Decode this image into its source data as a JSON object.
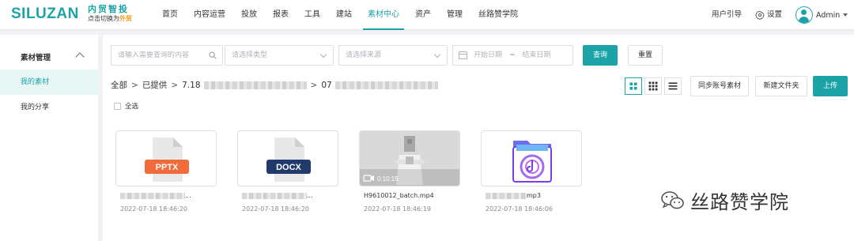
{
  "brand": {
    "logo_text": "SILUZAN",
    "name": "内贸智投",
    "switch_prefix": "点击切换为",
    "switch_target": "外贸"
  },
  "nav": {
    "items": [
      {
        "label": "首页"
      },
      {
        "label": "内容运营"
      },
      {
        "label": "投放"
      },
      {
        "label": "报表"
      },
      {
        "label": "工具"
      },
      {
        "label": "建站"
      },
      {
        "label": "素材中心"
      },
      {
        "label": "资产"
      },
      {
        "label": "管理"
      },
      {
        "label": "丝路赞学院"
      }
    ],
    "active_index": 6
  },
  "header_right": {
    "guide": "用户引导",
    "settings": "设置",
    "user": "Admin"
  },
  "sidebar": {
    "group_label": "素材管理",
    "items": [
      {
        "label": "我的素材",
        "active": true
      },
      {
        "label": "我的分享",
        "active": false
      }
    ]
  },
  "filters": {
    "search_placeholder": "请输入需要查询的内容",
    "type_placeholder": "请选择类型",
    "source_placeholder": "请选择来源",
    "start_date": "开始日期",
    "date_sep": "~",
    "end_date": "结束日期",
    "query_button": "查询",
    "reset_button": "重置"
  },
  "breadcrumb": {
    "root": "全部",
    "level1": "已提供",
    "level2_prefix": "7.18",
    "level3_prefix": "07"
  },
  "toolbar": {
    "sync_button": "同步账号素材",
    "new_folder_button": "新建文件夹",
    "upload_button": "上传"
  },
  "select_all_label": "全选",
  "files": [
    {
      "type_label": "PPTX",
      "name_suffix": "...",
      "date": "2022-07-18 18:46:20"
    },
    {
      "type_label": "DOCX",
      "name_suffix": "...",
      "date": "2022-07-18 18:46:20"
    },
    {
      "type_label": "video",
      "duration": "0:10:15",
      "name": "H9610012_batch.mp4",
      "date": "2022-07-18 18:46:19"
    },
    {
      "type_label": "audio",
      "name_suffix": "mp3",
      "date": "2022-07-18 18:46:06"
    }
  ],
  "watermark": "丝路赞学院",
  "colors": {
    "accent": "#1ca3a8",
    "pptx": "#f26b3a",
    "docx": "#1f3a6b",
    "audio": "#7b3fe4",
    "brand_orange": "#f39c12"
  }
}
